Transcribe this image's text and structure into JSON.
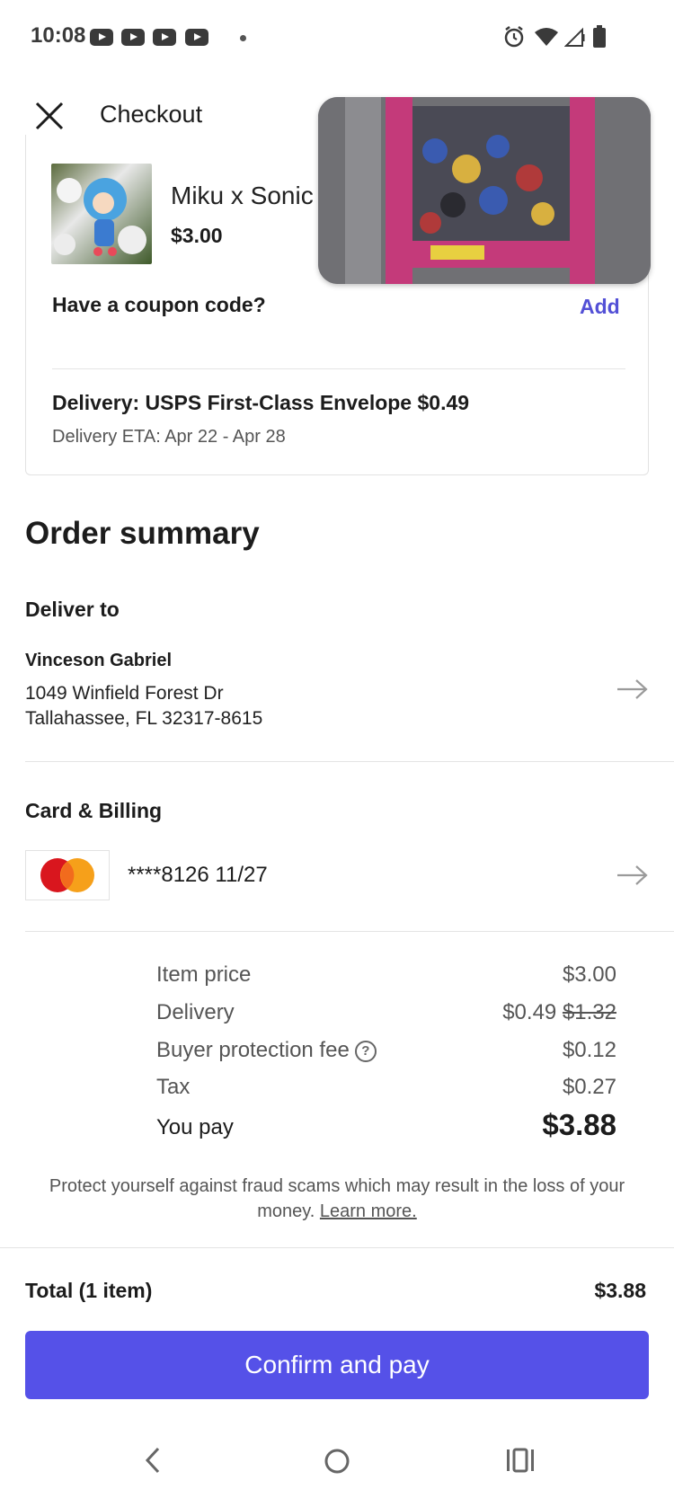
{
  "status_bar": {
    "time": "10:08"
  },
  "header": {
    "title": "Checkout"
  },
  "item": {
    "name": "Miku x Sonic",
    "price": "$3.00"
  },
  "coupon": {
    "label": "Have a coupon code?",
    "action": "Add"
  },
  "delivery": {
    "method": "Delivery: USPS First-Class Envelope $0.49",
    "eta": "Delivery ETA: Apr 22 - Apr 28"
  },
  "order_summary": {
    "title": "Order summary",
    "deliver_to": {
      "heading": "Deliver to",
      "name": "Vinceson Gabriel",
      "line1": "1049 Winfield Forest Dr",
      "line2": "Tallahassee, FL 32317-8615"
    },
    "billing": {
      "heading": "Card & Billing",
      "card_brand": "MasterCard",
      "card_text": "****8126 11/27"
    }
  },
  "pricing": {
    "rows": [
      {
        "label": "Item price",
        "value": "$3.00",
        "old": ""
      },
      {
        "label": "Delivery",
        "value": "$0.49",
        "old": "$1.32"
      },
      {
        "label": "Buyer protection fee",
        "value": "$0.12",
        "old": ""
      },
      {
        "label": "Tax",
        "value": "$0.27",
        "old": ""
      }
    ],
    "you_pay_label": "You pay",
    "you_pay_value": "$3.88",
    "help_glyph": "?"
  },
  "fraud_notice": {
    "text": "Protect yourself against fraud scams which may result in the loss of your money.",
    "link": "Learn more."
  },
  "footer": {
    "total_label": "Total (1 item)",
    "total_value": "$3.88",
    "button": "Confirm and pay"
  },
  "colors": {
    "accent": "#5551e8",
    "link": "#5350d6"
  }
}
